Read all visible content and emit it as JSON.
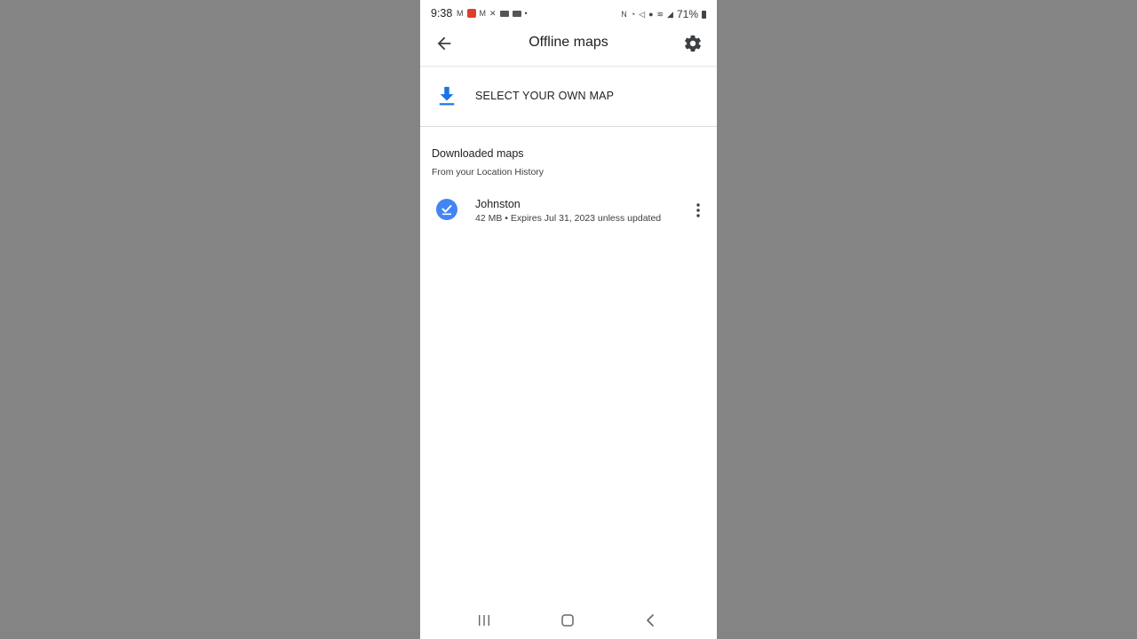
{
  "status_bar": {
    "time": "9:38",
    "battery": "71%"
  },
  "app_bar": {
    "title": "Offline maps",
    "back_icon": "arrow-back-icon",
    "settings_icon": "gear-icon"
  },
  "select_own_map": {
    "label": "SELECT YOUR OWN MAP",
    "icon": "download-icon",
    "accent": "#1a73e8"
  },
  "downloaded": {
    "title": "Downloaded maps",
    "subtitle": "From your Location History",
    "items": [
      {
        "name": "Johnston",
        "details": "42 MB • Expires Jul 31, 2023 unless updated",
        "icon": "check-circle-icon",
        "menu_icon": "more-vert-icon"
      }
    ]
  },
  "colors": {
    "background": "#848484",
    "accent_blue": "#4285f4"
  }
}
